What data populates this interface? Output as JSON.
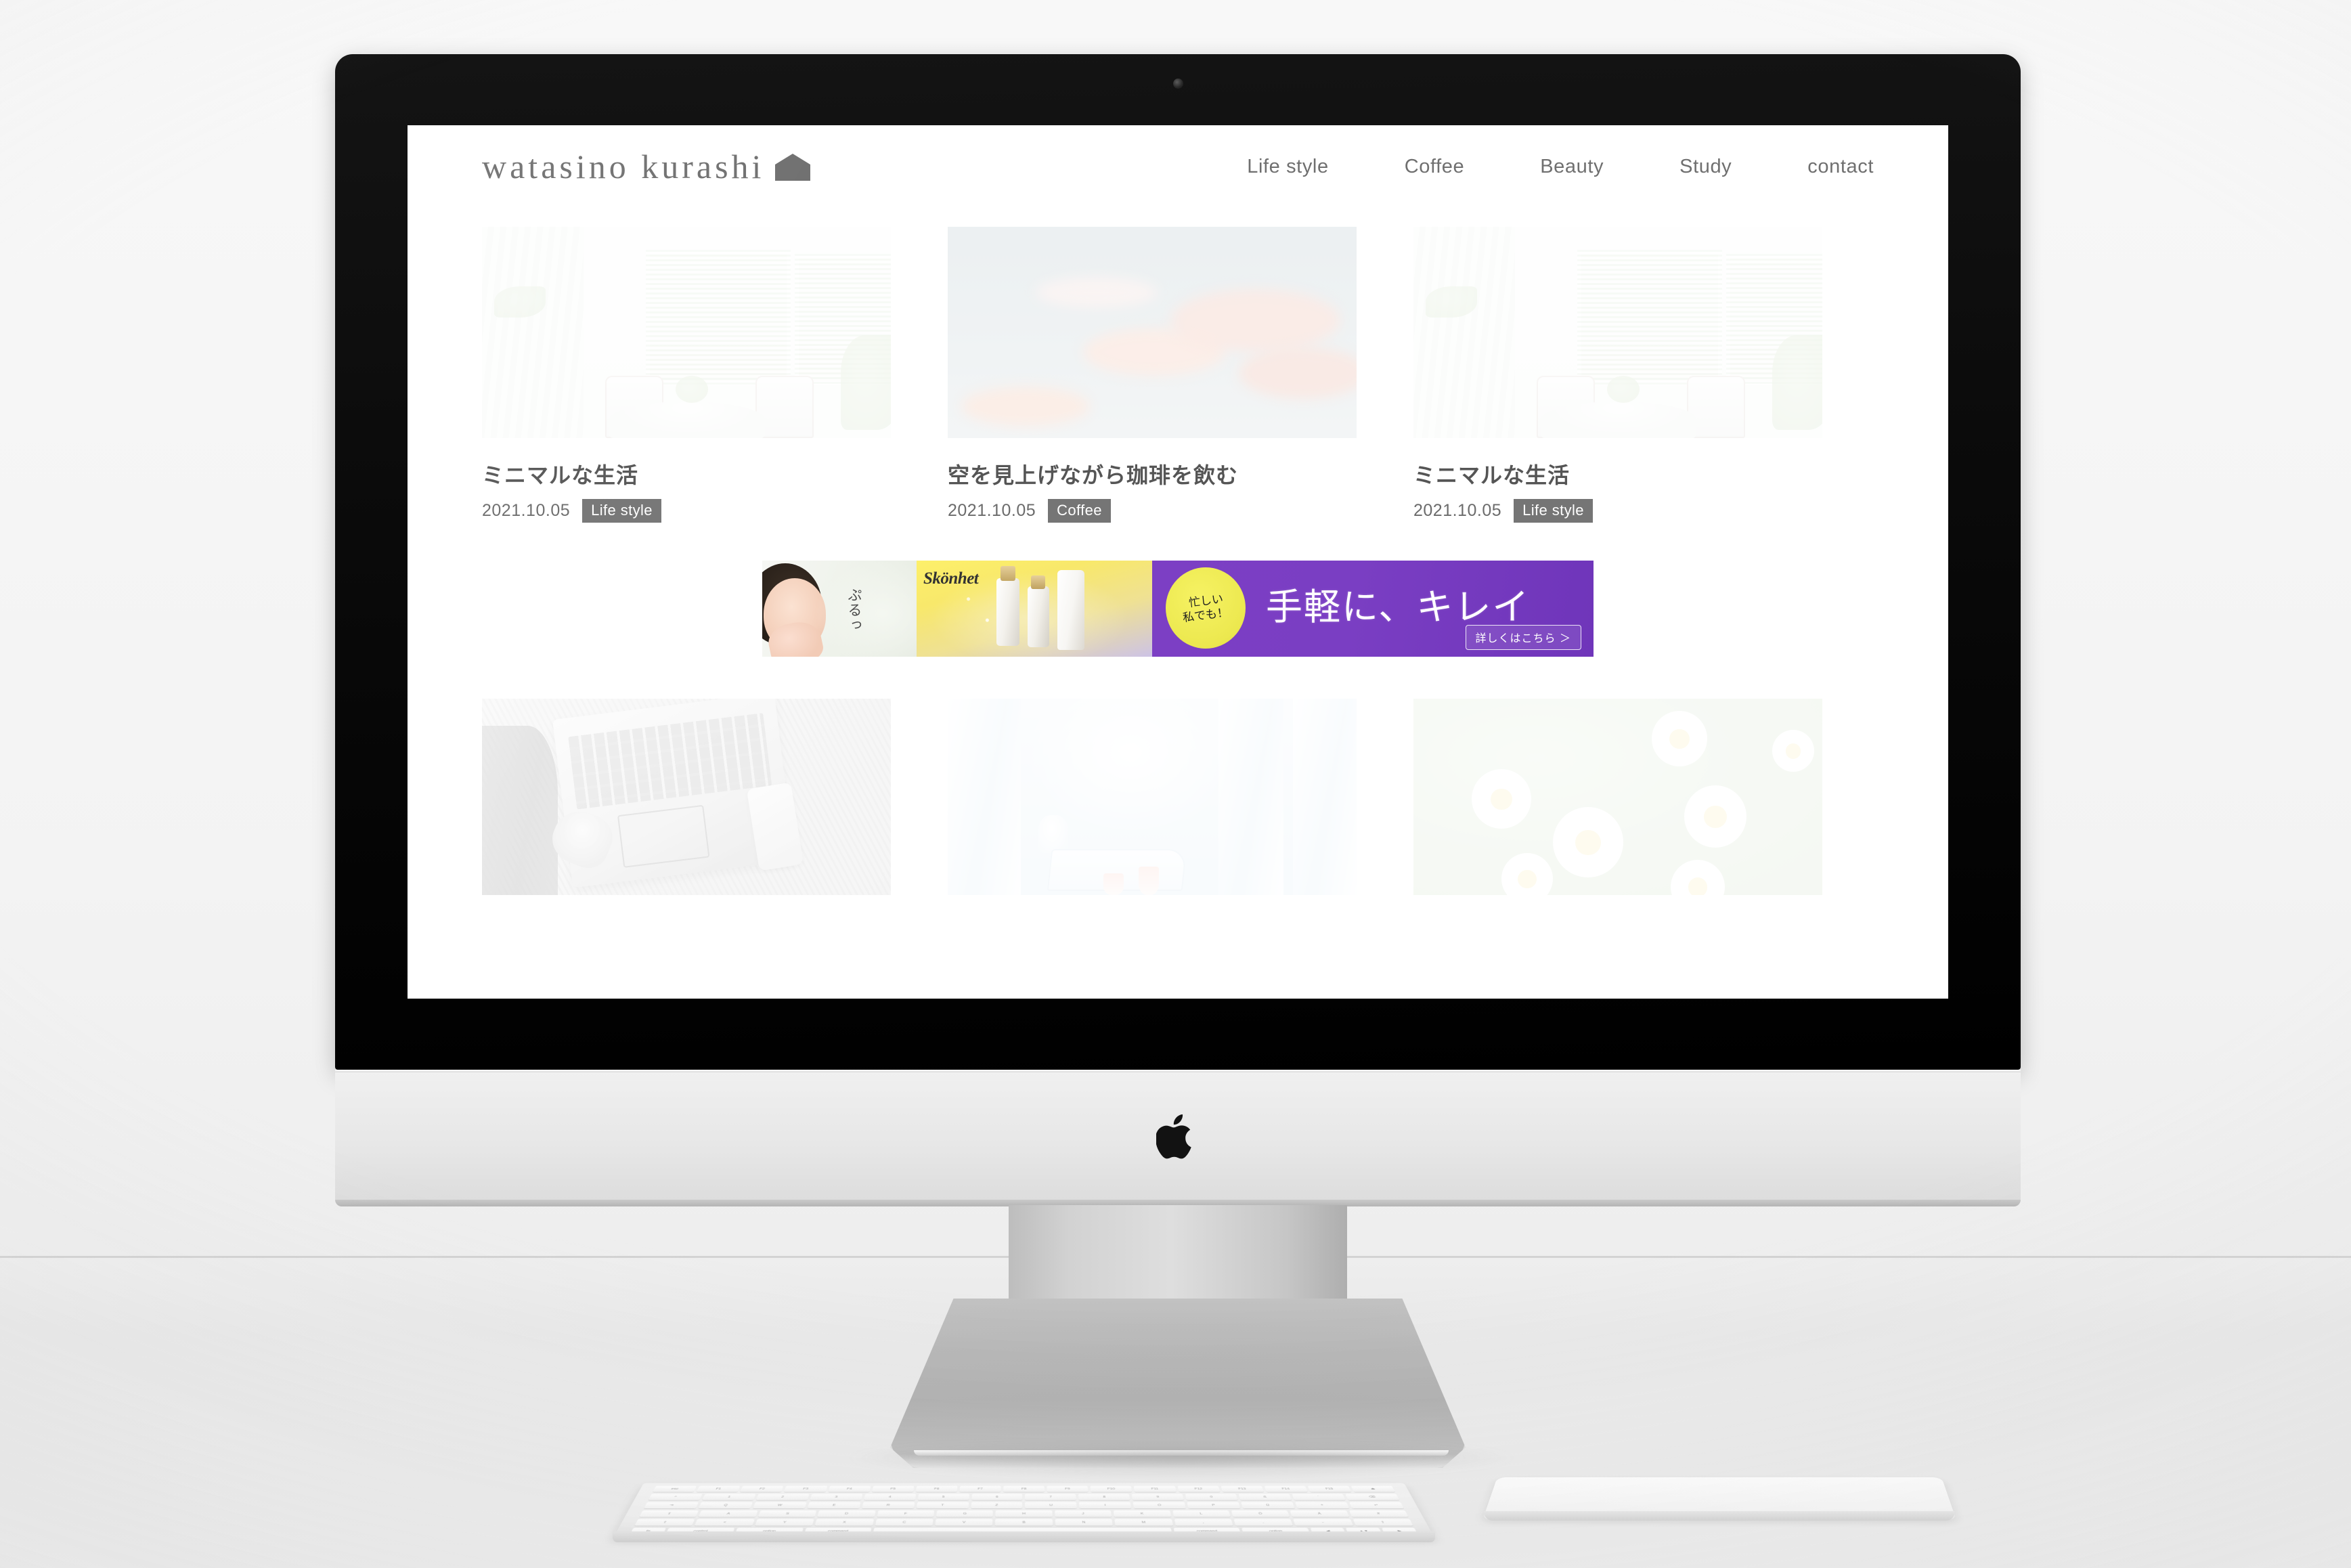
{
  "device": {
    "name": "iMac desktop computer",
    "logo_icon": "apple-logo-icon",
    "webcam_icon": "webcam-icon",
    "peripherals": {
      "keyboard": "magic-keyboard",
      "trackpad": "magic-trackpad"
    },
    "keyboard_rows": [
      [
        "esc",
        "F1",
        "F2",
        "F3",
        "F4",
        "F5",
        "F6",
        "F7",
        "F8",
        "F9",
        "F10",
        "F11",
        "F12",
        "F13",
        "F14",
        "F15",
        "⏏"
      ],
      [
        "^",
        "1",
        "2",
        "3",
        "4",
        "5",
        "6",
        "7",
        "8",
        "9",
        "0",
        "ß",
        "´",
        "⌫"
      ],
      [
        "⇥",
        "Q",
        "W",
        "E",
        "R",
        "T",
        "Z",
        "U",
        "I",
        "O",
        "P",
        "Ü",
        "+",
        "↵"
      ],
      [
        "⇪",
        "A",
        "S",
        "D",
        "F",
        "G",
        "H",
        "J",
        "K",
        "L",
        "Ö",
        "Ä",
        "#"
      ],
      [
        "⇧",
        "<",
        "Y",
        "X",
        "C",
        "V",
        "B",
        "N",
        "M",
        ",",
        ".",
        "-",
        "⇧"
      ],
      [
        "fn",
        "control",
        "option",
        "command",
        "",
        "command",
        "option",
        "◀",
        "▲▼",
        "▶"
      ]
    ]
  },
  "site": {
    "logo_text": "watasino  kurashi",
    "logo_mark_icon": "house-icon",
    "nav": [
      {
        "label": "Life style"
      },
      {
        "label": "Coffee"
      },
      {
        "label": "Beauty"
      },
      {
        "label": "Study"
      },
      {
        "label": "contact"
      }
    ],
    "cards_top": [
      {
        "title": "ミニマルな生活",
        "date": "2021.10.05",
        "tag": "Life style",
        "thumb": "bright-interior-bay-window-photo"
      },
      {
        "title": "空を見上げながら珈琲を飲む",
        "date": "2021.10.05",
        "tag": "Coffee",
        "thumb": "pastel-sky-clouds-photo"
      },
      {
        "title": "ミニマルな生活",
        "date": "2021.10.05",
        "tag": "Life style",
        "thumb": "bright-interior-bay-window-photo"
      }
    ],
    "cards_bottom": [
      {
        "thumb": "laptop-on-rug-photo"
      },
      {
        "thumb": "terrace-with-curtains-photo"
      },
      {
        "thumb": "white-daisies-photo"
      }
    ],
    "ad": {
      "brand": "Skönhet",
      "catch": "ぷるっ",
      "badge_line1": "忙しい",
      "badge_line2": "私でも！",
      "headline": "手軽に、キレイ",
      "cta": "詳しくはこちら ＞",
      "colors": {
        "purple": "#7c3fc4",
        "yellow": "#f6ef6a",
        "badge": "#f0ec52"
      }
    },
    "colors": {
      "text": "#6f6f6f",
      "tag_bg": "#757575",
      "page_bg": "#ffffff"
    }
  }
}
